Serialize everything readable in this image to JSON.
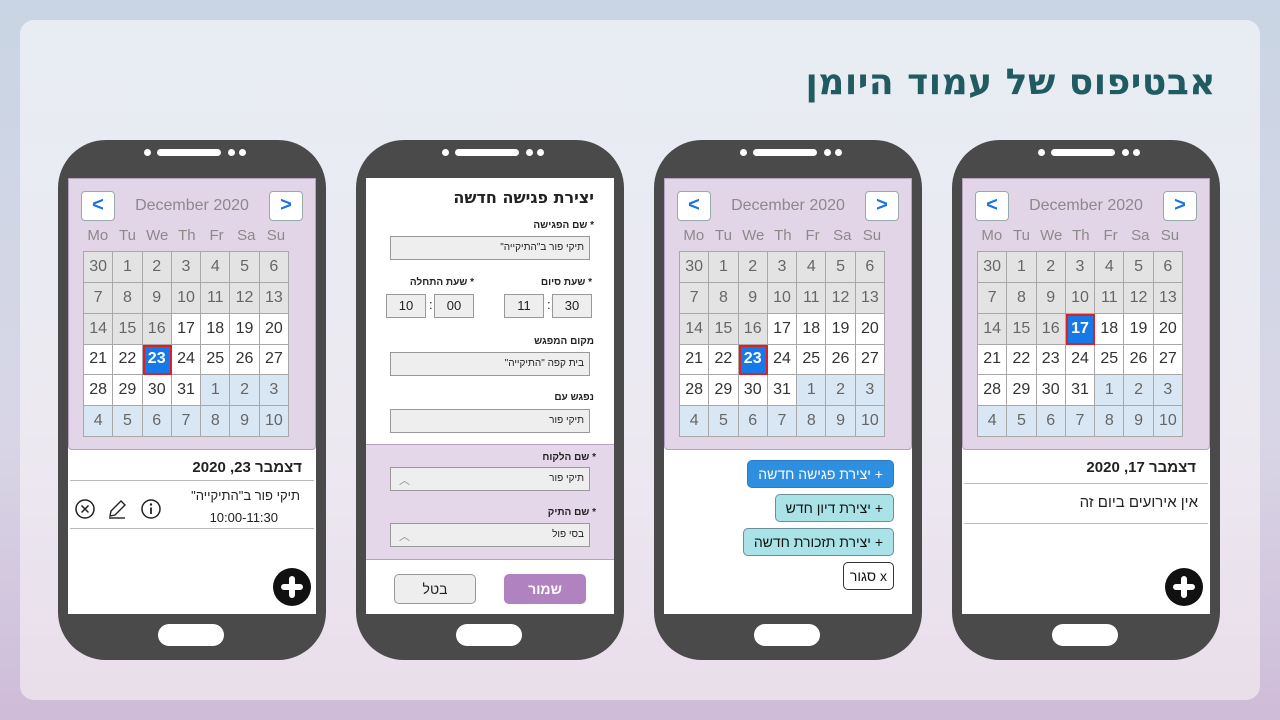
{
  "page_title": "אבטיפוס של עמוד היומן",
  "calendar": {
    "prev_label": "<",
    "next_label": ">",
    "month_label": "December 2020",
    "weekdays": [
      "Mo",
      "Tu",
      "We",
      "Th",
      "Fr",
      "Sa",
      "Su"
    ],
    "days": [
      [
        "30",
        "1",
        "2",
        "3",
        "4",
        "5",
        "6"
      ],
      [
        "7",
        "8",
        "9",
        "10",
        "11",
        "12",
        "13"
      ],
      [
        "14",
        "15",
        "16",
        "17",
        "18",
        "19",
        "20"
      ],
      [
        "21",
        "22",
        "23",
        "24",
        "25",
        "26",
        "27"
      ],
      [
        "28",
        "29",
        "30",
        "31",
        "1",
        "2",
        "3"
      ],
      [
        "4",
        "5",
        "6",
        "7",
        "8",
        "9",
        "10"
      ]
    ]
  },
  "phone1": {
    "day_title": "דצמבר 17, 2020",
    "no_events": "אין אירועים ביום זה",
    "selected_day": "17"
  },
  "phone2": {
    "selected_day": "23",
    "menu": {
      "new_meeting": "+ יצירת פגישה חדשה",
      "new_hearing": "+ יצירת דיון חדש",
      "new_reminder": "+ יצירת תזכורת חדשה",
      "close": "x סגור"
    }
  },
  "phone3": {
    "title": "יצירת פגישה חדשה",
    "meeting_name_label": "* שם הפגישה",
    "meeting_name_value": "תיקי פור ב\"התיקייה\"",
    "end_time_label": "* שעת סיום",
    "start_time_label": "* שעת התחלה",
    "start_hour": "10",
    "start_minute": "00",
    "end_hour": "11",
    "end_minute": "30",
    "location_label": "מקום המפגש",
    "location_value": "בית קפה \"התיקייה\"",
    "meet_with_label": "נפגש עם",
    "meet_with_value": "תיקי פור",
    "client_label": "* שם הלקוח",
    "client_value": "תיקי פור",
    "case_label": "* שם התיק",
    "case_value": "בסי פול",
    "save_label": "שמור",
    "cancel_label": "בטל"
  },
  "phone4": {
    "selected_day": "23",
    "day_title": "דצמבר 23, 2020",
    "event_title": "תיקי פור ב\"התיקייה\"",
    "event_time": "10:00-11:30"
  },
  "colors": {
    "title": "#215b62",
    "calendar_bg": "#e3d5e8",
    "selected": "#1679e8",
    "accent_button": "#2e8fe0",
    "teal_button": "#a9e3e7",
    "save_button": "#b083c0"
  }
}
